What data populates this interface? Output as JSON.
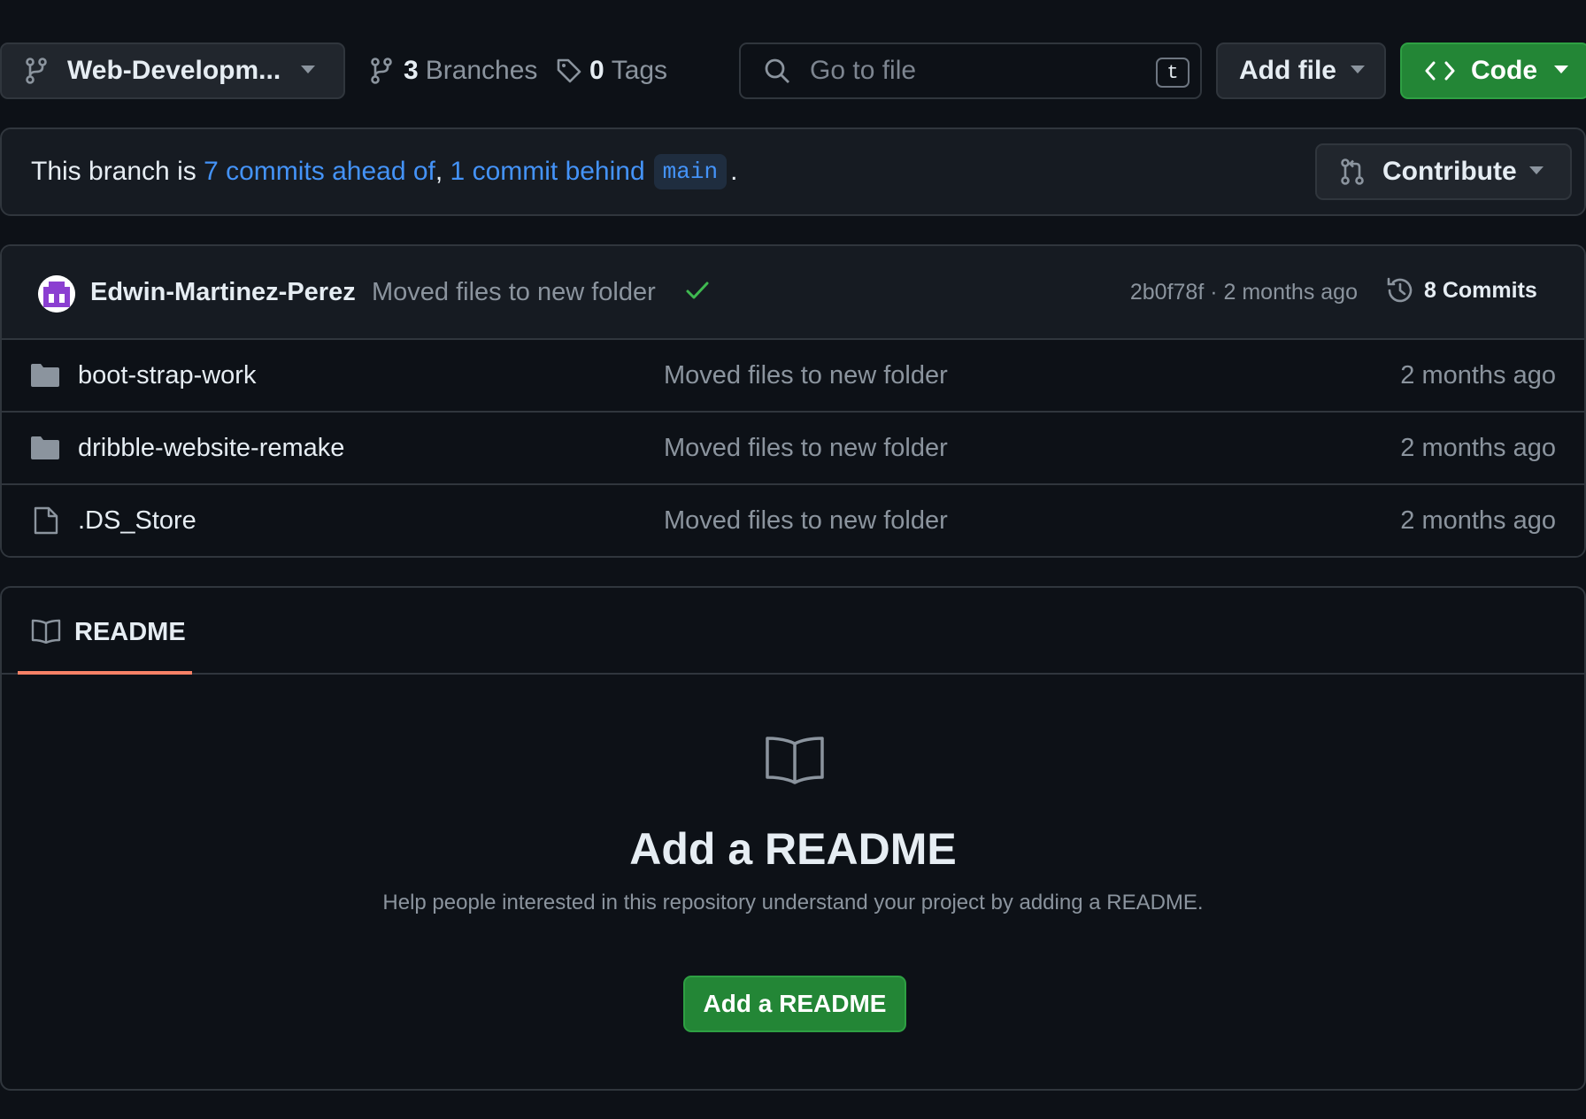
{
  "toolbar": {
    "branch_name": "Web-Developm...",
    "branches_count": "3",
    "branches_label": "Branches",
    "tags_count": "0",
    "tags_label": "Tags",
    "search_placeholder": "Go to file",
    "search_shortcut": "t",
    "add_file_label": "Add file",
    "code_label": "Code"
  },
  "banner": {
    "prefix": "This branch is ",
    "ahead_link": "7 commits ahead of",
    "separator": ", ",
    "behind_link": "1 commit behind",
    "base_branch": "main",
    "suffix": ".",
    "contribute_label": "Contribute"
  },
  "latest_commit": {
    "author": "Edwin-Martinez-Perez",
    "message": "Moved files to new folder",
    "status": "success",
    "sha_and_time": "2b0f78f · 2 months ago",
    "commits_count_label": "8 Commits"
  },
  "files": [
    {
      "type": "folder",
      "name": "boot-strap-work",
      "message": "Moved files to new folder",
      "time": "2 months ago"
    },
    {
      "type": "folder",
      "name": "dribble-website-remake",
      "message": "Moved files to new folder",
      "time": "2 months ago"
    },
    {
      "type": "file",
      "name": ".DS_Store",
      "message": "Moved files to new folder",
      "time": "2 months ago"
    }
  ],
  "readme": {
    "tab_label": "README",
    "title": "Add a README",
    "description": "Help people interested in this repository understand your project by adding a README.",
    "button_label": "Add a README"
  },
  "colors": {
    "background": "#0d1117",
    "surface": "#161b22",
    "border": "#30363d",
    "link": "#4493f8",
    "primary_button": "#238636",
    "success": "#3fb950",
    "tab_underline": "#f78166",
    "avatar_accent": "#8b3fd1"
  }
}
